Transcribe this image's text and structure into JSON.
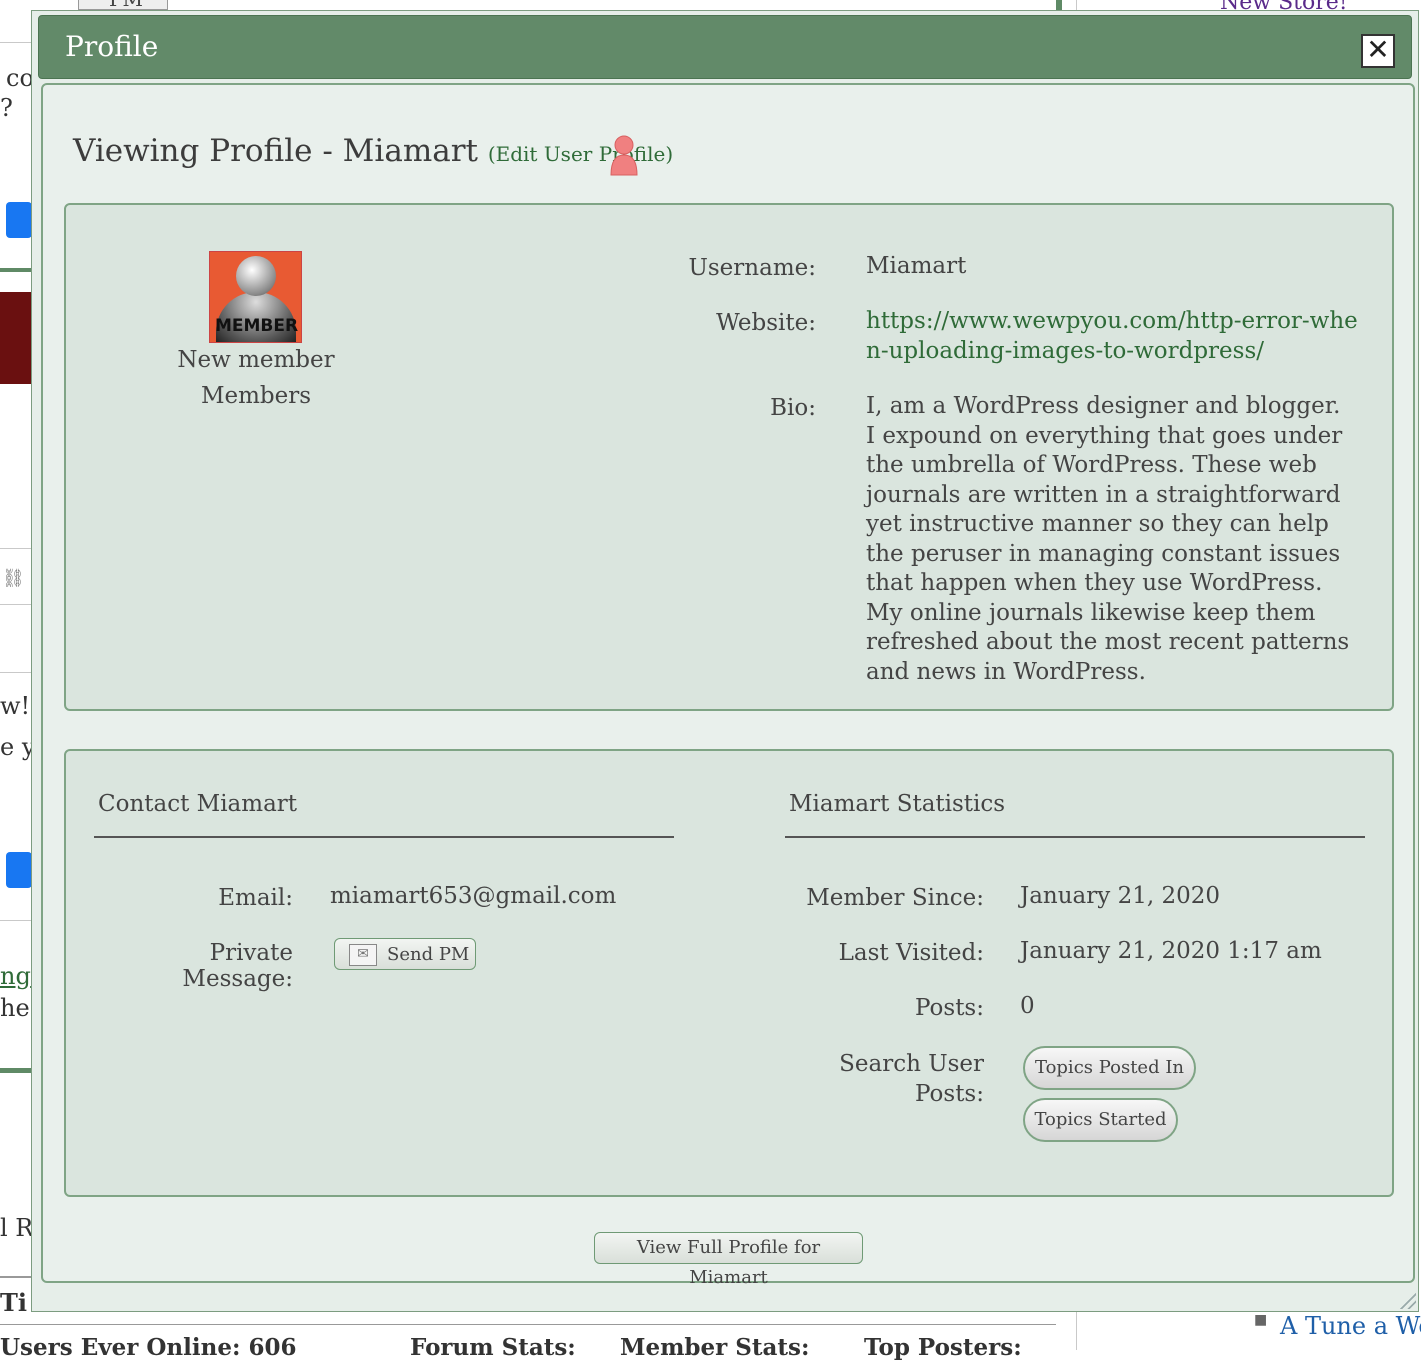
{
  "background": {
    "pm_button": "PM",
    "store_link": "New Store!",
    "fragment_co": "co",
    "fragment_q": "?",
    "fragment_w": "w! ",
    "fragment_ey": "e y",
    "fragment_ng": "ng",
    "fragment_he": "he",
    "fragment_r": "l R",
    "fragment_ti": "Ti",
    "fragment_users": "Users Ever Online: 606",
    "fragment_forum": "Forum Stats:",
    "fragment_member": "Member Stats:",
    "fragment_top": "Top Posters:",
    "sidebar_link": "A Tune a Wee"
  },
  "modal": {
    "title": "Profile",
    "close_symbol": "✕"
  },
  "profile": {
    "heading": "Viewing Profile - Miamart",
    "edit_link": "(Edit User Profile)",
    "rank": "New member",
    "group": "Members",
    "avatar_text": "MEMBER",
    "fields": {
      "username_label": "Username:",
      "username": "Miamart",
      "website_label": "Website:",
      "website": "https://www.wewpyou.com/http-error-when-uploading-images-to-wordpress/",
      "bio_label": "Bio:",
      "bio": "I, am a WordPress designer and blogger. I expound on everything that goes under the umbrella of WordPress. These web journals are written in a straightforward yet instructive manner so they can help the peruser in managing constant issues that happen when they use WordPress. My online journals likewise keep them refreshed about the most recent patterns and news in WordPress."
    }
  },
  "contact": {
    "title": "Contact Miamart",
    "email_label": "Email:",
    "email": "miamart653@gmail.com",
    "pm_label": "Private Message:",
    "pm_button": "Send PM"
  },
  "stats": {
    "title": "Miamart Statistics",
    "member_since_label": "Member Since:",
    "member_since": "January 21, 2020",
    "last_visited_label": "Last Visited:",
    "last_visited": "January 21, 2020 1:17 am",
    "posts_label": "Posts:",
    "posts": "0",
    "search_label": "Search User Posts:",
    "topics_posted_button": "Topics Posted In",
    "topics_started_button": "Topics Started"
  },
  "footer": {
    "full_profile_button": "View Full Profile for Miamart"
  },
  "colors": {
    "title_bar": "#628a69",
    "panel_bg": "#dae5de",
    "border": "#7fa485",
    "link": "#2f6b38"
  }
}
